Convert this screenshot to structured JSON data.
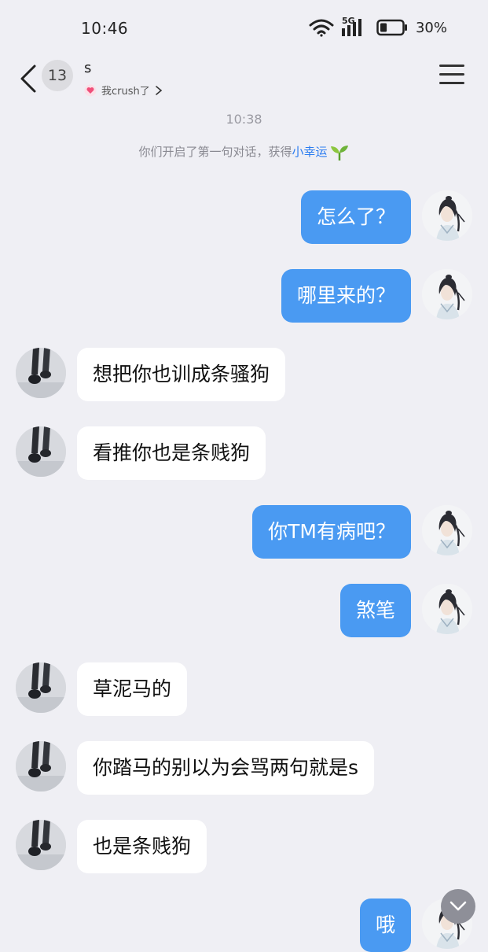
{
  "status_bar": {
    "time": "10:46",
    "network": "5G",
    "battery_percent": "30%",
    "battery_level": 0.3
  },
  "header": {
    "back_icon": "chevron-left-icon",
    "unread_count": "13",
    "contact_name": "s",
    "subtitle": "我crush了",
    "menu_icon": "hamburger-menu-icon"
  },
  "chat": {
    "timestamp": "10:38",
    "system_message_prefix": "你们开启了第一句对话，获得",
    "system_message_highlight": "小幸运",
    "messages": [
      {
        "sender": "me",
        "text": "怎么了？"
      },
      {
        "sender": "me",
        "text": "哪里来的？"
      },
      {
        "sender": "other",
        "text": "想把你也训成条骚狗"
      },
      {
        "sender": "other",
        "text": "看推你也是条贱狗"
      },
      {
        "sender": "me",
        "text": "你TM有病吧？"
      },
      {
        "sender": "me",
        "text": "煞笔"
      },
      {
        "sender": "other",
        "text": "草泥马的"
      },
      {
        "sender": "other",
        "text": "你踏马的别以为会骂两句就是s"
      },
      {
        "sender": "other",
        "text": "也是条贱狗"
      },
      {
        "sender": "me",
        "text": "哦"
      }
    ]
  },
  "colors": {
    "background": "#efeff4",
    "my_bubble": "#4a9af2",
    "other_bubble": "#ffffff",
    "highlight": "#2b7cf0"
  }
}
